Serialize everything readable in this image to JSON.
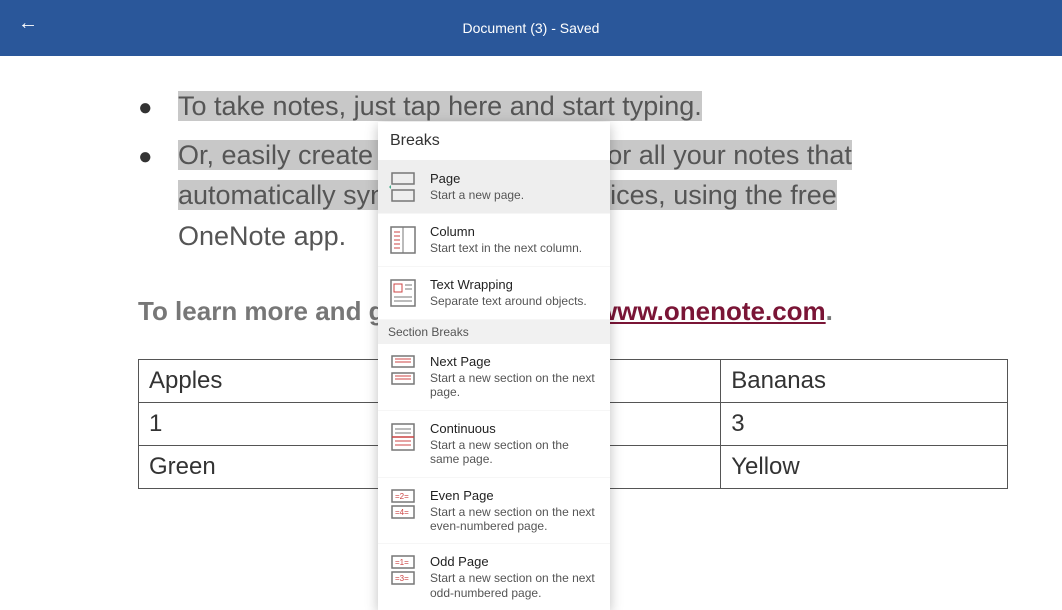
{
  "header": {
    "title": "Document (3) - Saved"
  },
  "content": {
    "bullet1": "To take notes, just tap here and start typing.",
    "bullet2_line1": "Or, easily create a digital notebook for all your notes that",
    "bullet2_line2": "automatically syncs across your devices, using the free",
    "bullet2_line3": "OneNote app.",
    "learn_prefix": "To learn more and get OneNote, visit ",
    "learn_link": "www.onenote.com",
    "learn_suffix": "."
  },
  "table": {
    "r1c1": "Apples",
    "r1c2": "",
    "r1c3": "Bananas",
    "r2c1": "1",
    "r2c2": "",
    "r2c3": "3",
    "r3c1": "Green",
    "r3c2": "",
    "r3c3": "Yellow"
  },
  "dropdown": {
    "header": "Breaks",
    "section2": "Section Breaks",
    "items": [
      {
        "title": "Page",
        "desc": "Start a new page."
      },
      {
        "title": "Column",
        "desc": "Start text in the next column."
      },
      {
        "title": "Text Wrapping",
        "desc": "Separate text around objects."
      }
    ],
    "section_items": [
      {
        "title": "Next Page",
        "desc": "Start a new section on the next page."
      },
      {
        "title": "Continuous",
        "desc": "Start a new section on the same page."
      },
      {
        "title": "Even Page",
        "desc": "Start a new section on the next even-numbered page."
      },
      {
        "title": "Odd Page",
        "desc": "Start a new section on the next odd-numbered page."
      }
    ]
  }
}
